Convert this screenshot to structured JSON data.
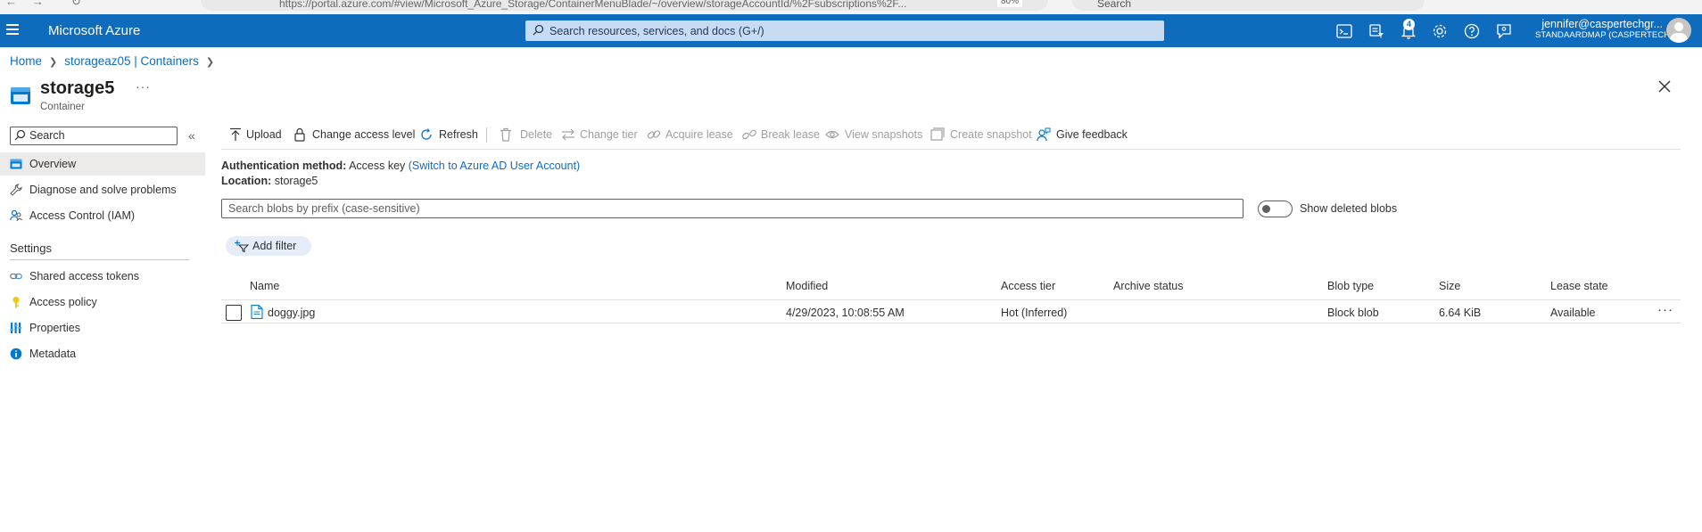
{
  "browser": {
    "url_text": "https://portal.azure.com/#view/Microsoft_Azure_Storage/ContainerMenuBlade/~/overview/storageAccountId/%2Fsubscriptions%2F...",
    "zoom": "80%",
    "search_text": "Search"
  },
  "topbar": {
    "brand": "Microsoft Azure",
    "search_placeholder": "Search resources, services, and docs (G+/)",
    "notification_count": "4",
    "user_email": "jennifer@caspertechgr...",
    "user_directory": "STANDAARDMAP (CASPERTECH..."
  },
  "breadcrumb": {
    "items": [
      "Home",
      "storageaz05 | Containers"
    ]
  },
  "header": {
    "title": "storage5",
    "subtitle": "Container",
    "more": "···"
  },
  "sidebar": {
    "search_placeholder": "Search",
    "collapse": "«",
    "items": [
      {
        "label": "Overview",
        "icon": "overview-icon",
        "selected": true
      },
      {
        "label": "Diagnose and solve problems",
        "icon": "wrench-icon"
      },
      {
        "label": "Access Control (IAM)",
        "icon": "people-icon"
      }
    ],
    "settings_header": "Settings",
    "settings_items": [
      {
        "label": "Shared access tokens",
        "icon": "link-icon"
      },
      {
        "label": "Access policy",
        "icon": "key-icon"
      },
      {
        "label": "Properties",
        "icon": "properties-icon"
      },
      {
        "label": "Metadata",
        "icon": "info-icon"
      }
    ]
  },
  "toolbar": {
    "upload": "Upload",
    "change_access_level": "Change access level",
    "refresh": "Refresh",
    "delete": "Delete",
    "change_tier": "Change tier",
    "acquire_lease": "Acquire lease",
    "break_lease": "Break lease",
    "view_snapshots": "View snapshots",
    "create_snapshot": "Create snapshot",
    "give_feedback": "Give feedback"
  },
  "info": {
    "auth_label": "Authentication method:",
    "auth_value": "Access key",
    "auth_link": "(Switch to Azure AD User Account)",
    "location_label": "Location:",
    "location_value": "storage5"
  },
  "blob_search": {
    "placeholder": "Search blobs by prefix (case-sensitive)"
  },
  "show_deleted": {
    "label": "Show deleted blobs",
    "on": false
  },
  "filter": {
    "add_filter": "Add filter"
  },
  "table": {
    "columns": [
      "Name",
      "Modified",
      "Access tier",
      "Archive status",
      "Blob type",
      "Size",
      "Lease state"
    ],
    "rows": [
      {
        "name": "doggy.jpg",
        "modified": "4/29/2023, 10:08:55 AM",
        "access_tier": "Hot (Inferred)",
        "archive_status": "",
        "blob_type": "Block blob",
        "size": "6.64 KiB",
        "lease_state": "Available"
      }
    ],
    "row_more": "···"
  },
  "colors": {
    "accent": "#0f6cbd",
    "topbar_bg": "#0f6cbd",
    "selected_nav_bg": "#edebe9",
    "disabled_text": "#a19f9d"
  }
}
